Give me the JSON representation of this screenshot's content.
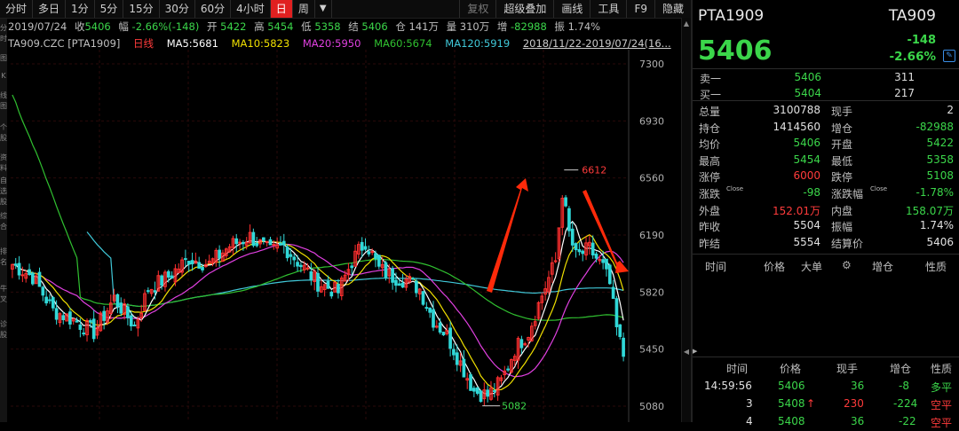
{
  "toolbar": {
    "periods": [
      "分时",
      "多日",
      "1分",
      "5分",
      "15分",
      "30分",
      "60分",
      "4小时",
      "日",
      "周"
    ],
    "active_period": "日",
    "more_icon": "▼",
    "tools": [
      "复权",
      "超级叠加",
      "画线",
      "工具",
      "F9",
      "隐藏"
    ],
    "tools_dim": [
      "复权"
    ]
  },
  "left_strip": {
    "marks": [
      "分",
      "时",
      "图",
      "K",
      "线",
      "图",
      "个",
      "股",
      "资",
      "料",
      "自",
      "选",
      "股",
      "综",
      "合",
      "排",
      "名",
      "牛",
      "叉",
      "诊",
      "股"
    ]
  },
  "infobar": {
    "date": "2019/07/24",
    "close_label": "收",
    "close": "5406",
    "amp_label": "幅",
    "amp": "-2.66%(-148)",
    "open_label": "开",
    "open": "5422",
    "high_label": "高",
    "high": "5454",
    "low_label": "低",
    "low": "5358",
    "settle_label": "结",
    "settle": "5406",
    "oi_label": "仓",
    "oi": "141万",
    "vol_label": "量",
    "vol": "310万",
    "inc_label": "增",
    "inc": "-82988",
    "zhen_label": "振",
    "zhen": "1.74%"
  },
  "mabar": {
    "symbol": "TA909.CZC [PTA1909]",
    "period": "日线",
    "ma5": "MA5:5681",
    "ma10": "MA10:5823",
    "ma20": "MA20:5950",
    "ma60": "MA60:5674",
    "ma120": "MA120:5919",
    "range": "2018/11/22-2019/07/24(16...",
    "ctrl": [
      "—",
      "+",
      "▲",
      "▼"
    ],
    "colors": {
      "period": "#ff3b3b",
      "ma5": "#ffffff",
      "ma10": "#f0e000",
      "ma20": "#e040e0",
      "ma60": "#30c030",
      "ma120": "#40c8d8"
    }
  },
  "chart_data": {
    "type": "candlestick",
    "yticks": [
      "7300",
      "6930",
      "6560",
      "6190",
      "5820",
      "5450",
      "5080"
    ],
    "annotations": {
      "peak_label": "6612",
      "trough_label": "5082"
    },
    "colors": {
      "up": "#ff3030",
      "down": "#30d8d8",
      "grid": "#2a0a0a",
      "arrow": "#ff2a0a"
    }
  },
  "right_panel": {
    "name": "PTA1909",
    "code": "TA909",
    "price": "5406",
    "change": "-148",
    "change_pct": "-2.66%",
    "orderbook": [
      {
        "label": "卖一",
        "price": "5406",
        "vol": "311"
      },
      {
        "label": "买一",
        "price": "5404",
        "vol": "217"
      }
    ],
    "stats": [
      {
        "l1": "总量",
        "v1": "3100788",
        "c1": "w",
        "l2": "现手",
        "v2": "2",
        "c2": "w"
      },
      {
        "l1": "持仓",
        "v1": "1414560",
        "c1": "w",
        "l2": "增仓",
        "v2": "-82988",
        "c2": "dn"
      },
      {
        "l1": "均价",
        "v1": "5406",
        "c1": "dn",
        "l2": "开盘",
        "v2": "5422",
        "c2": "dn"
      },
      {
        "l1": "最高",
        "v1": "5454",
        "c1": "dn",
        "l2": "最低",
        "v2": "5358",
        "c2": "dn"
      },
      {
        "l1": "涨停",
        "v1": "6000",
        "c1": "up",
        "l2": "跌停",
        "v2": "5108",
        "c2": "dn"
      },
      {
        "l1": "涨跌",
        "l1sup": "Close",
        "v1": "-98",
        "c1": "dn",
        "l2": "涨跌幅",
        "l2sup": "Close",
        "v2": "-1.78%",
        "c2": "dn"
      },
      {
        "l1": "外盘",
        "v1": "152.01万",
        "c1": "up",
        "l2": "内盘",
        "v2": "158.07万",
        "c2": "dn"
      },
      {
        "l1": "昨收",
        "v1": "5504",
        "c1": "w",
        "l2": "振幅",
        "v2": "1.74%",
        "c2": "w"
      },
      {
        "l1": "昨结",
        "v1": "5554",
        "c1": "w",
        "l2": "结算价",
        "v2": "5406",
        "c2": "w"
      }
    ],
    "trades_header": [
      "时间",
      "价格",
      "大单",
      "增仓",
      "性质"
    ],
    "ticks_header": [
      "时间",
      "价格",
      "现手",
      "增仓",
      "性质"
    ],
    "ticks": [
      {
        "time": "14:59:56",
        "price": "5406",
        "price_color": "dn",
        "vol": "36",
        "vol_color": "dn",
        "inc": "-8",
        "inc_color": "dn",
        "nature": "多平",
        "nature_color": "dn"
      },
      {
        "time": "3",
        "price": "5408",
        "price_color": "dn",
        "arrow": "↑",
        "vol": "230",
        "vol_color": "up",
        "inc": "-224",
        "inc_color": "dn",
        "nature": "空平",
        "nature_color": "up"
      },
      {
        "time": "4",
        "price": "5408",
        "price_color": "dn",
        "vol": "36",
        "vol_color": "dn",
        "inc": "-22",
        "inc_color": "dn",
        "nature": "空平",
        "nature_color": "up"
      }
    ]
  }
}
